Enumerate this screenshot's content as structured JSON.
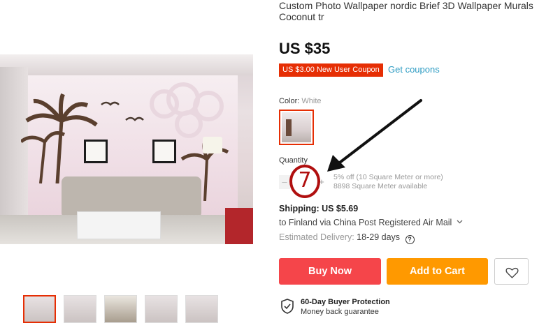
{
  "product": {
    "title": "Custom Photo Wallpaper nordic Brief 3D Wallpaper Murals Coconut tr\nMural Decor Living Room Bedroom",
    "price": "US $35",
    "coupon_badge": "US $3.00 New User Coupon",
    "get_coupons": "Get coupons"
  },
  "color": {
    "label": "Color:",
    "value": "White"
  },
  "quantity": {
    "label": "Quantity",
    "minus": "–",
    "plus": "+",
    "annotation_value": "7",
    "discount_text": "5% off (10 Square Meter or more)",
    "available_text": "8898 Square Meter available"
  },
  "shipping": {
    "title": "Shipping: US $5.69",
    "via": "to Finland via China Post Registered Air Mail",
    "delivery_label": "Estimated Delivery:",
    "delivery_days": "18-29 days",
    "help": "?"
  },
  "actions": {
    "buy_now": "Buy Now",
    "add_to_cart": "Add to Cart"
  },
  "protection": {
    "title": "60-Day Buyer Protection",
    "subtitle": "Money back guarantee"
  },
  "colors": {
    "accent_red": "#e62e04",
    "buy_now": "#f5454a",
    "add_to_cart": "#ff9900",
    "link": "#2e9cc3",
    "annotation": "#b00f0f"
  },
  "icons": [
    "heart-icon",
    "shield-check-icon",
    "question-circle-icon",
    "chevron-down-icon",
    "arrow-annotation"
  ]
}
